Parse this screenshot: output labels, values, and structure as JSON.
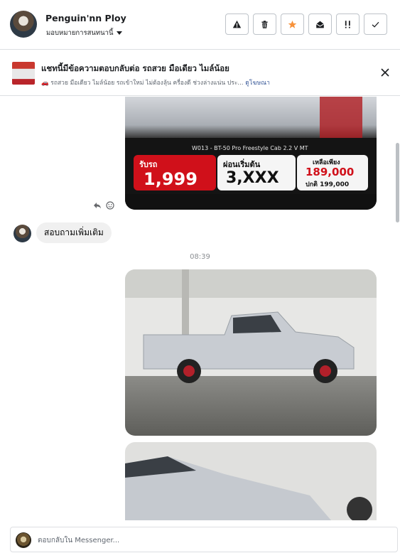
{
  "header": {
    "name": "Penguin'nn Ploy",
    "assign_label": "มอบหมายการสนทนานี้",
    "actions": [
      {
        "icon": "warning-icon"
      },
      {
        "icon": "trash-icon"
      },
      {
        "icon": "star-icon",
        "color": "#f7923b"
      },
      {
        "icon": "mark-unread-icon"
      },
      {
        "icon": "follow-up-icon"
      },
      {
        "icon": "check-icon"
      }
    ]
  },
  "ad_banner": {
    "title": "แชทนี้มีข้อความตอบกลับต่อ รถสวย มือเดียว ไมล์น้อย",
    "subtitle": "🚗 รถสวย มือเดียว ไมล์น้อย รถเข้าใหม่ ไม่ต้องลุ้น ครื่องดี ช่วงล่างแน่น ประ...",
    "link": "ดูโฆษณา"
  },
  "conversation": {
    "ad_image": {
      "model_line": "W013 - BT-50 Pro Freestyle Cab 2.2 V MT",
      "receive_label": "รับรถ",
      "receive_value": "1,999",
      "installment_label": "ผ่อนเริ่มต้น",
      "installment_value": "3,XXX",
      "remaining_label": "เหลือเพียง",
      "sale_price": "189,000",
      "normal_price": "ปกติ 199,000"
    },
    "incoming_message": "สอบถามเพิ่มเติม",
    "timestamp": "08:39"
  },
  "composer": {
    "placeholder": "ตอบกลับใน Messenger..."
  },
  "colors": {
    "accent_link": "#385898",
    "star": "#f7923b",
    "price_red": "#d0101a"
  }
}
